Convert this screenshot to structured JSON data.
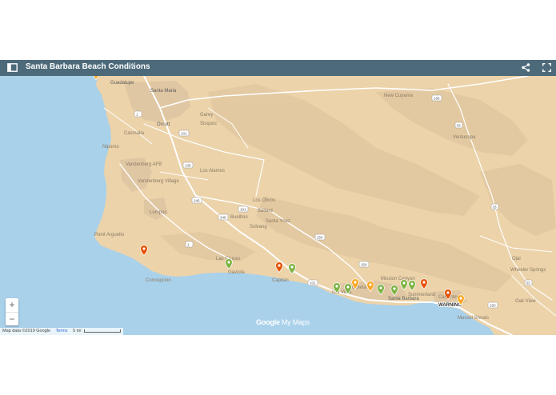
{
  "header": {
    "title": "Santa Barbara Beach Conditions"
  },
  "icons": {
    "sidebar": "sidebar-toggle-icon",
    "star": "star-icon",
    "share": "share-icon",
    "fullscreen": "fullscreen-icon"
  },
  "colors": {
    "header": "#4d6a7a",
    "land": "#ecd3aa",
    "water": "#a9d1ea",
    "marker_good": "#7cb342",
    "marker_caution": "#f9a825",
    "marker_warning": "#e65100"
  },
  "places": [
    {
      "name": "Guadalupe"
    },
    {
      "name": "Santa Maria"
    },
    {
      "name": "Orcutt"
    },
    {
      "name": "Garey"
    },
    {
      "name": "Sisquoc"
    },
    {
      "name": "Casmalia"
    },
    {
      "name": "Vandenberg AFB"
    },
    {
      "name": "Vandenberg Village"
    },
    {
      "name": "Lompoc"
    },
    {
      "name": "Los Alamos"
    },
    {
      "name": "Los Olivos"
    },
    {
      "name": "Ballard"
    },
    {
      "name": "Buellton"
    },
    {
      "name": "Santa Ynez"
    },
    {
      "name": "Solvang"
    },
    {
      "name": "Las Cruces"
    },
    {
      "name": "Gaviota"
    },
    {
      "name": "Capitan"
    },
    {
      "name": "Mission Canyon"
    },
    {
      "name": "Isla Vista"
    },
    {
      "name": "Goleta"
    },
    {
      "name": "Santa Barbara"
    },
    {
      "name": "Summerland"
    },
    {
      "name": "Carpinteria"
    },
    {
      "name": "Mussel Shoals"
    },
    {
      "name": "New Cuyama"
    },
    {
      "name": "Ventucopa"
    },
    {
      "name": "Ojai"
    },
    {
      "name": "Wheeler Springs"
    },
    {
      "name": "Oak View"
    },
    {
      "name": "Nipomo"
    },
    {
      "name": "Point Arguello"
    },
    {
      "name": "Concepcion"
    }
  ],
  "highways": [
    {
      "label": "166"
    },
    {
      "label": "1"
    },
    {
      "label": "101"
    },
    {
      "label": "135"
    },
    {
      "label": "246"
    },
    {
      "label": "154"
    },
    {
      "label": "33"
    },
    {
      "label": "150"
    },
    {
      "label": "192"
    }
  ],
  "markers": [
    {
      "status": "warning"
    },
    {
      "status": "caution"
    },
    {
      "status": "good"
    },
    {
      "status": "warning"
    },
    {
      "status": "good"
    },
    {
      "status": "good"
    },
    {
      "status": "good"
    },
    {
      "status": "caution"
    },
    {
      "status": "caution"
    },
    {
      "status": "good"
    },
    {
      "status": "good"
    },
    {
      "status": "good"
    },
    {
      "status": "good"
    },
    {
      "status": "warning"
    },
    {
      "status": "warning"
    },
    {
      "status": "caution"
    }
  ],
  "warning_label": "WARNING",
  "zoom": {
    "in": "+",
    "out": "−"
  },
  "attribution": {
    "map_data": "Map data ©2019 Google",
    "terms": "Terms",
    "scale": "5 mi"
  },
  "logo": {
    "google": "Google",
    "suffix": "My Maps"
  }
}
